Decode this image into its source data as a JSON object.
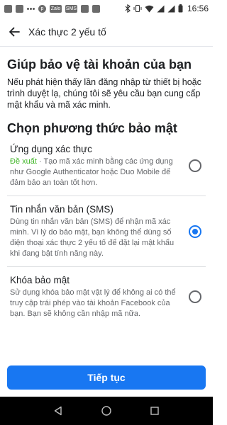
{
  "status_bar": {
    "time": "16:56",
    "notification_icons": [
      "calendar-icon",
      "message-icon",
      "dots-icon",
      "p-app-icon",
      "zalo-icon",
      "sms-icon",
      "phone-icon",
      "image-icon"
    ],
    "notif_labels": {
      "zalo": "Zalo",
      "sms": "SMS"
    },
    "system_icons": [
      "bluetooth-icon",
      "vibrate-icon",
      "wifi-icon",
      "signal-icon",
      "signal-icon-2",
      "battery-icon"
    ]
  },
  "app_bar": {
    "title": "Xác thực 2 yếu tố",
    "back_icon": "back-arrow-icon"
  },
  "main": {
    "headline": "Giúp bảo vệ tài khoản của bạn",
    "intro": "Nếu phát hiện thấy lần đăng nhập từ thiết bị hoặc trình duyệt lạ, chúng tôi sẽ yêu cầu bạn cung cấp mật khẩu và mã xác minh.",
    "section_title": "Chọn phương thức bảo mật",
    "options": [
      {
        "title": "Ứng dụng xác thực",
        "tag": "Đề xuất",
        "desc": " · Tạo mã xác minh bằng các ứng dụng như Google Authenticator hoặc Duo Mobile để đảm bảo an toàn tốt hơn.",
        "selected": false
      },
      {
        "title": "Tin nhắn văn bản (SMS)",
        "tag": "",
        "desc": "Dùng tin nhắn văn bản (SMS) để nhận mã xác minh. Vì lý do bảo mật, bạn không thể dùng số điện thoại xác thực 2 yếu tố để đặt lại mật khẩu khi đang bật tính năng này.",
        "selected": true
      },
      {
        "title": "Khóa bảo mật",
        "tag": "",
        "desc": "Sử dụng khóa bảo mật vật lý để không ai có thể truy cập trái phép vào tài khoản Facebook của bạn. Bạn sẽ không cần nhập mã nữa.",
        "selected": false
      }
    ]
  },
  "footer": {
    "continue_label": "Tiếp tục"
  },
  "nav_bar": {
    "icons": [
      "nav-back-icon",
      "nav-home-icon",
      "nav-recents-icon"
    ]
  },
  "colors": {
    "accent": "#1877f2",
    "recommended": "#42b72a",
    "text": "#1c1e21",
    "secondary_text": "#65676b"
  }
}
